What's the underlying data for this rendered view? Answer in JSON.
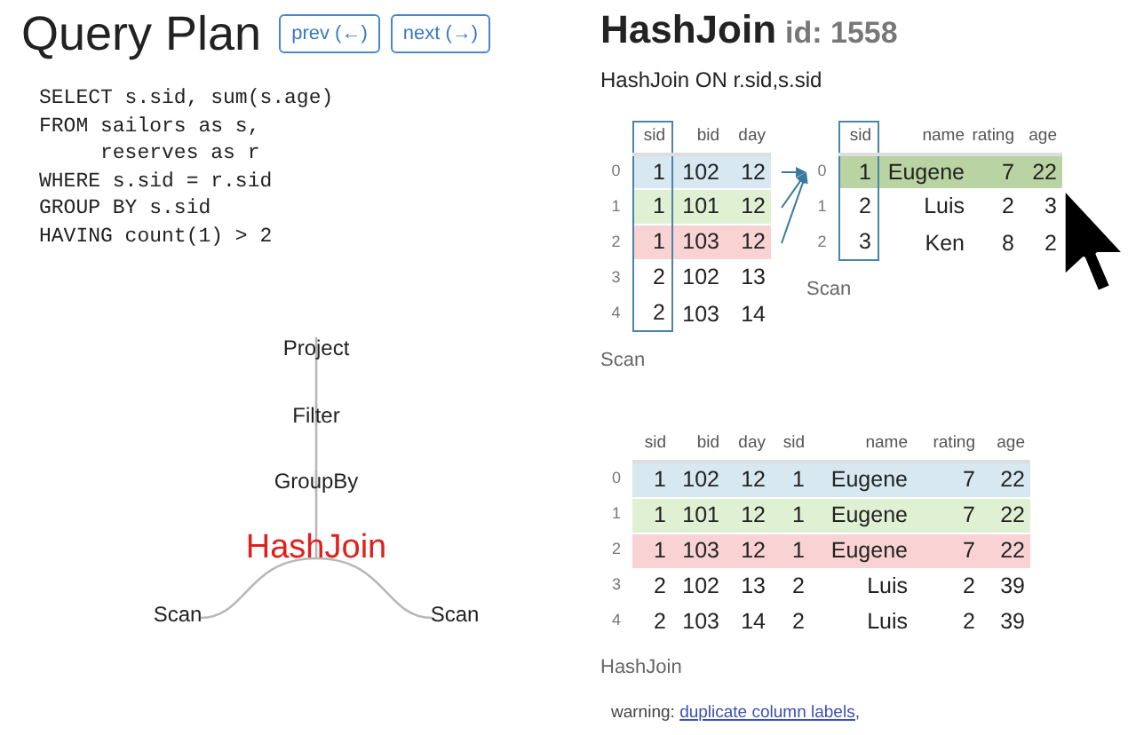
{
  "query_panel": {
    "title": "Query Plan",
    "buttons": [
      "prev (←)",
      "next (→)"
    ],
    "sql": [
      "SELECT s.sid, sum(s.age)",
      "FROM sailors as s,",
      "     reserves as r",
      "WHERE s.sid = r.sid",
      "GROUP BY s.sid",
      "HAVING count(1) > 2"
    ],
    "plan": {
      "label": "Project",
      "selected": false,
      "children": [
        {
          "label": "Filter",
          "selected": false,
          "children": [
            {
              "label": "GroupBy",
              "selected": false,
              "children": [
                {
                  "label": "HashJoin",
                  "selected": true,
                  "children": [
                    {
                      "label": "Scan",
                      "selected": false
                    },
                    {
                      "label": "Scan",
                      "selected": false
                    }
                  ]
                }
              ]
            }
          ]
        }
      ]
    }
  },
  "detail_panel": {
    "title": "HashJoin",
    "id": "id: 1558",
    "subtitle": "HashJoin ON r.sid,s.sid",
    "inputs": [
      {
        "caption": "Scan",
        "columns": [
          {
            "label": "sid",
            "key": true
          },
          {
            "label": "bid",
            "key": false
          },
          {
            "label": "day",
            "key": false
          }
        ],
        "rows": [
          {
            "index": "0",
            "cells": [
              "1",
              "102",
              "12"
            ],
            "color": "#d7e8f1"
          },
          {
            "index": "1",
            "cells": [
              "1",
              "101",
              "12"
            ],
            "color": "#dff0d3"
          },
          {
            "index": "2",
            "cells": [
              "1",
              "103",
              "12"
            ],
            "color": "#f9d3d3"
          },
          {
            "index": "3",
            "cells": [
              "2",
              "102",
              "13"
            ]
          },
          {
            "index": "4",
            "cells": [
              "2",
              "103",
              "14"
            ]
          }
        ]
      },
      {
        "caption": "Scan",
        "columns": [
          {
            "label": "sid",
            "key": true
          },
          {
            "label": "name",
            "key": false
          },
          {
            "label": "rating",
            "key": false
          },
          {
            "label": "age",
            "key": false
          }
        ],
        "rows": [
          {
            "index": "0",
            "cells": [
              "1",
              "Eugene",
              "7",
              "22"
            ],
            "color": "#b9d3a2"
          },
          {
            "index": "1",
            "cells": [
              "2",
              "Luis",
              "2",
              "3"
            ]
          },
          {
            "index": "2",
            "cells": [
              "3",
              "Ken",
              "8",
              "2"
            ]
          }
        ]
      }
    ],
    "output": {
      "caption": "HashJoin",
      "columns": [
        {
          "label": "sid",
          "key": false
        },
        {
          "label": "bid",
          "key": false
        },
        {
          "label": "day",
          "key": false
        },
        {
          "label": "sid",
          "key": false
        },
        {
          "label": "name",
          "key": false
        },
        {
          "label": "rating",
          "key": false
        },
        {
          "label": "age",
          "key": false
        }
      ],
      "rows": [
        {
          "index": "0",
          "cells": [
            "1",
            "102",
            "12",
            "1",
            "Eugene",
            "7",
            "22"
          ],
          "color": "#d7e8f1"
        },
        {
          "index": "1",
          "cells": [
            "1",
            "101",
            "12",
            "1",
            "Eugene",
            "7",
            "22"
          ],
          "color": "#dff0d3"
        },
        {
          "index": "2",
          "cells": [
            "1",
            "103",
            "12",
            "1",
            "Eugene",
            "7",
            "22"
          ],
          "color": "#f9d3d3"
        },
        {
          "index": "3",
          "cells": [
            "2",
            "102",
            "13",
            "2",
            "Luis",
            "2",
            "39"
          ]
        },
        {
          "index": "4",
          "cells": [
            "2",
            "103",
            "14",
            "2",
            "Luis",
            "2",
            "39"
          ]
        }
      ]
    },
    "warning": {
      "text": "warning: ",
      "link": "duplicate column labels,"
    }
  }
}
